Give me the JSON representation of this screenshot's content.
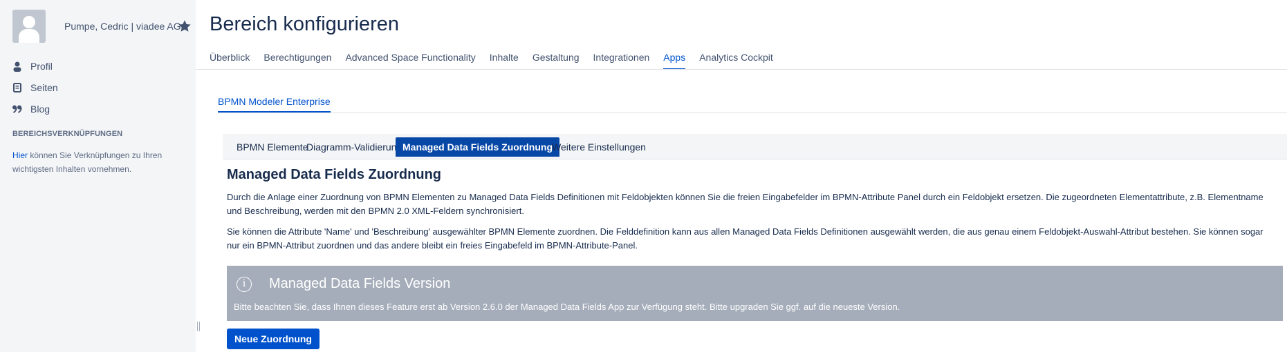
{
  "sidebar": {
    "space_name": "Pumpe, Cedric | viadee AG",
    "nav": [
      {
        "label": "Profil",
        "icon": "person-icon"
      },
      {
        "label": "Seiten",
        "icon": "pages-icon"
      },
      {
        "label": "Blog",
        "icon": "quote-icon"
      }
    ],
    "shortcuts_heading": "BEREICHSVERKNÜPFUNGEN",
    "help_link": "Hier",
    "help_text": " können Sie Verknüpfungen zu Ihren wichtigsten Inhalten vornehmen."
  },
  "header": {
    "title": "Bereich konfigurieren",
    "tabs": [
      {
        "label": "Überblick",
        "active": false
      },
      {
        "label": "Berechtigungen",
        "active": false
      },
      {
        "label": "Advanced Space Functionality",
        "active": false
      },
      {
        "label": "Inhalte",
        "active": false
      },
      {
        "label": "Gestaltung",
        "active": false
      },
      {
        "label": "Integrationen",
        "active": false
      },
      {
        "label": "Apps",
        "active": true
      },
      {
        "label": "Analytics Cockpit",
        "active": false
      }
    ]
  },
  "app": {
    "tab_label": "BPMN Modeler Enterprise",
    "sub_tabs": [
      {
        "label": "BPMN Elemente",
        "active": false
      },
      {
        "label": "Diagramm-Validierung",
        "active": false
      },
      {
        "label": "Managed Data Fields Zuordnung",
        "active": true
      },
      {
        "label": "Weitere Einstellungen",
        "active": false
      }
    ]
  },
  "content": {
    "title": "Managed Data Fields Zuordnung",
    "paragraph1": "Durch die Anlage einer Zuordnung von BPMN Elementen zu Managed Data Fields Definitionen mit Feldobjekten können Sie die freien Eingabefelder im BPMN-Attribute Panel durch ein Feldobjekt ersetzen. Die zugeordneten Elementattribute, z.B. Elementname und Beschreibung, werden mit den BPMN 2.0 XML-Feldern synchronisiert.",
    "paragraph2": "Sie können die Attribute 'Name' und 'Beschreibung' ausgewählter BPMN Elemente zuordnen. Die Felddefinition kann aus allen Managed Data Fields Definitionen ausgewählt werden, die aus genau einem Feldobjekt-Auswahl-Attribut bestehen. Sie können sogar nur ein BPMN-Attribut zuordnen und das andere bleibt ein freies Eingabefeld im BPMN-Attribute-Panel.",
    "info": {
      "icon": "info-icon",
      "title": "Managed Data Fields Version",
      "text": "Bitte beachten Sie, dass Ihnen dieses Feature erst ab Version 2.6.0 der Managed Data Fields App zur Verfügung steht. Bitte upgraden Sie ggf. auf die neueste Version."
    },
    "new_button": "Neue Zuordnung"
  },
  "colors": {
    "accent": "#0052cc",
    "active_subtab": "#0747a6",
    "info_bg": "#a5adba",
    "sidebar_bg": "#f4f5f7"
  }
}
